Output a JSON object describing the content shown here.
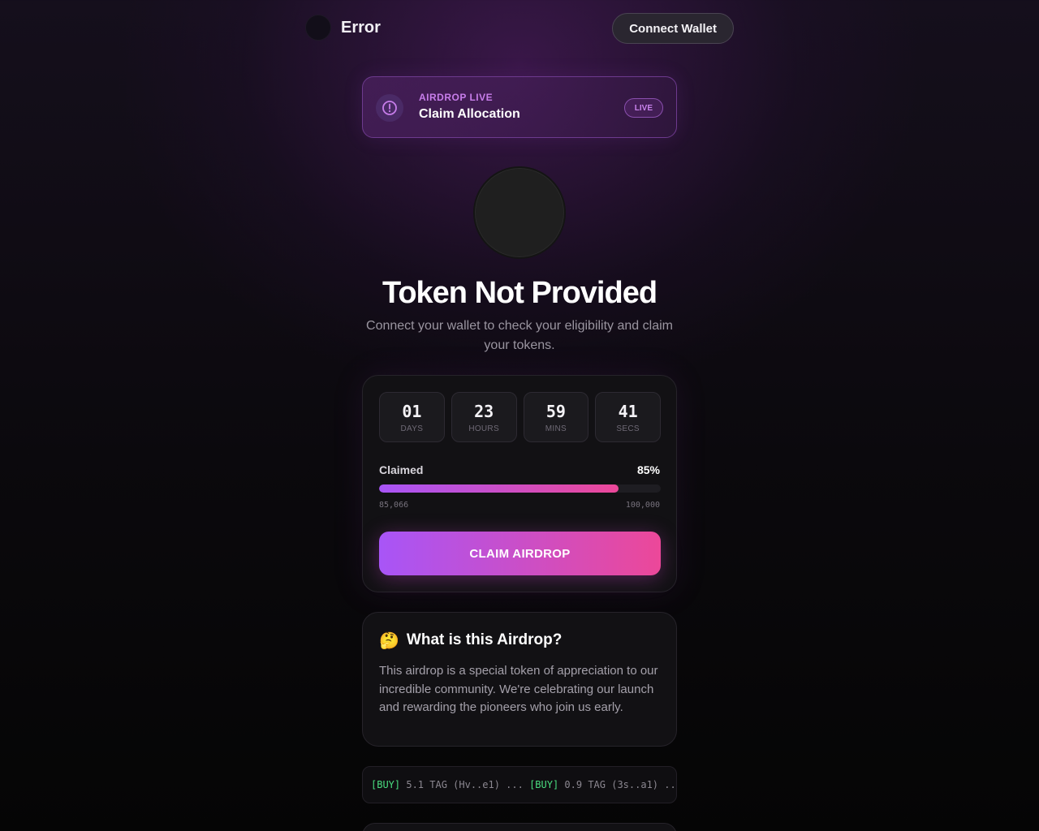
{
  "header": {
    "brand_name": "Error",
    "connect_label": "Connect Wallet"
  },
  "banner": {
    "kicker": "AIRDROP LIVE",
    "title": "Claim Allocation",
    "badge": "LIVE",
    "icon": "alert-circle-icon"
  },
  "hero": {
    "title": "Token Not Provided",
    "subtitle": "Connect your wallet to check your eligibility and claim your tokens."
  },
  "countdown": [
    {
      "value": "01",
      "label": "DAYS"
    },
    {
      "value": "23",
      "label": "HOURS"
    },
    {
      "value": "59",
      "label": "MINS"
    },
    {
      "value": "41",
      "label": "SECS"
    }
  ],
  "progress": {
    "label": "Claimed",
    "percent_label": "85%",
    "fraction": 0.85,
    "min_label": "85,066",
    "max_label": "100,000"
  },
  "claim_button": "CLAIM AIRDROP",
  "info": {
    "emoji": "🤔",
    "title": "What is this Airdrop?",
    "text": "This airdrop is a special token of appreciation to our incredible community. We're celebrating our launch and rewarding the pioneers who join us early."
  },
  "ticker": {
    "items": [
      {
        "tag": "[BUY]",
        "text": " 5.1 TAG (Hv..e1) ... "
      },
      {
        "tag": "[BUY]",
        "text": " 0.9 TAG (3s..a1) ..."
      }
    ]
  },
  "colors": {
    "accent_start": "#a855f7",
    "accent_end": "#ec4899",
    "buy_green": "#4ade80",
    "banner_kicker": "#c77dea"
  }
}
